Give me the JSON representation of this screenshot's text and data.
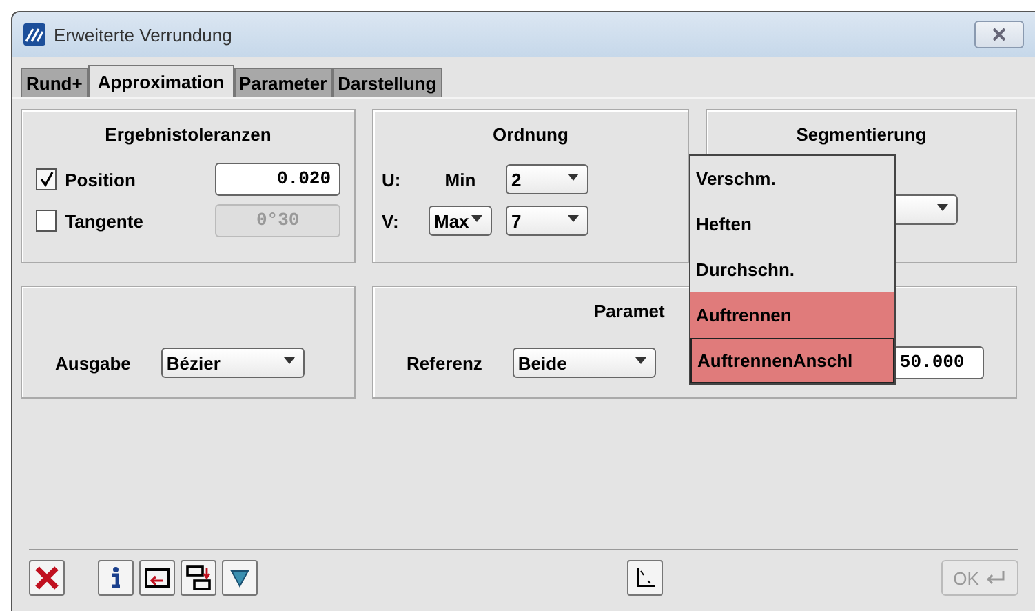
{
  "window": {
    "title": "Erweiterte Verrundung"
  },
  "tabs": [
    {
      "label": "Rund+",
      "selected": false
    },
    {
      "label": "Approximation",
      "selected": true
    },
    {
      "label": "Parameter",
      "selected": false
    },
    {
      "label": "Darstellung",
      "selected": false
    }
  ],
  "tolerances": {
    "title": "Ergebnistoleranzen",
    "rows": [
      {
        "label": "Position",
        "checked": true,
        "value": "0.020",
        "disabled": false
      },
      {
        "label": "Tangente",
        "checked": false,
        "value": "0°30",
        "disabled": true
      }
    ]
  },
  "order": {
    "title": "Ordnung",
    "rows": [
      {
        "axis": "U:",
        "mode": {
          "kind": "text",
          "value": "Min"
        },
        "degree": "2"
      },
      {
        "axis": "V:",
        "mode": {
          "kind": "select",
          "value": "Max"
        },
        "degree": "7"
      }
    ]
  },
  "segmentation": {
    "title": "Segmentierung"
  },
  "output": {
    "label": "Ausgabe",
    "value": "Bézier"
  },
  "parameter": {
    "title": "Paramet",
    "label": "Referenz",
    "value": "Beide",
    "field": "50.000"
  },
  "popup": {
    "items": [
      {
        "label": "Verschm.",
        "selected": false,
        "focused": false
      },
      {
        "label": "Heften",
        "selected": false,
        "focused": false
      },
      {
        "label": "Durchschn.",
        "selected": false,
        "focused": false
      },
      {
        "label": "Auftrennen",
        "selected": true,
        "focused": false
      },
      {
        "label": "AuftrennenAnschl",
        "selected": true,
        "focused": true
      }
    ]
  },
  "footer": {
    "ok": {
      "label": "OK",
      "disabled": true
    }
  }
}
